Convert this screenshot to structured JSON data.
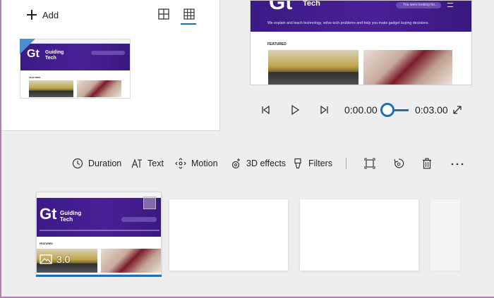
{
  "library": {
    "add_label": "Add",
    "view_toggle_icons": [
      "large-grid-icon",
      "small-grid-icon"
    ]
  },
  "site": {
    "logo": "Gt",
    "brand_line1": "Guiding",
    "brand_line2": "Tech",
    "preview_brand": "Tech",
    "tagline": "We explain and teach technology, solve tech problems and help you make gadget buying decisions.",
    "search_placeholder": "You were looking for...",
    "featured_label": "FEATURED"
  },
  "player": {
    "current_time": "0:00.00",
    "total_time": "0:03.00",
    "icons": [
      "previous-frame-icon",
      "play-icon",
      "next-frame-icon",
      "fullscreen-icon"
    ]
  },
  "toolbar": {
    "duration_label": "Duration",
    "text_label": "Text",
    "motion_label": "Motion",
    "effects_label": "3D effects",
    "filters_label": "Filters",
    "extra_icons": [
      "resize-icon",
      "rotate-icon",
      "delete-icon",
      "more-options-icon"
    ]
  },
  "storyboard": {
    "card1_duration": "3.0"
  },
  "colors": {
    "accent": "#1f6fb2",
    "site_purple": "#3c1a86",
    "background": "#eeeef1"
  }
}
